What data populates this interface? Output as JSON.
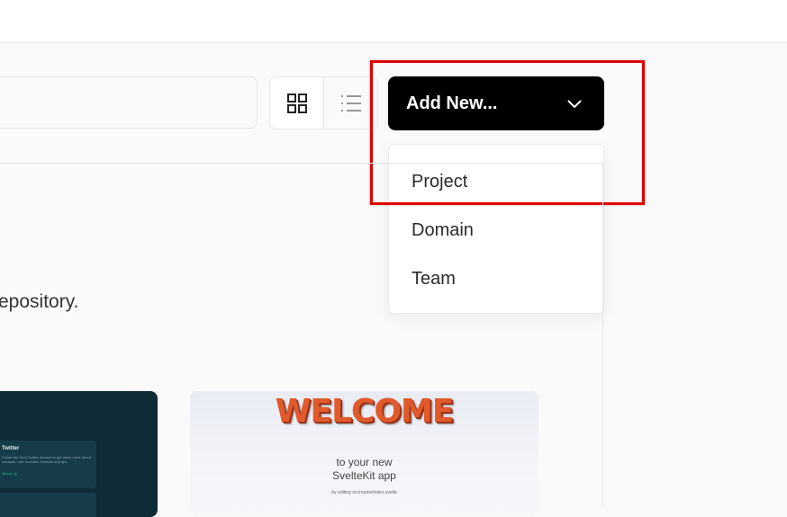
{
  "toolbar": {
    "view_icons": [
      "grid-view-icon",
      "list-view-icon"
    ],
    "add_new": {
      "label": "Add New...",
      "icon": "chevron-down-icon"
    }
  },
  "dropdown": {
    "items": [
      "Project",
      "Domain",
      "Team"
    ]
  },
  "content": {
    "description_fragment": "epository."
  },
  "templates": {
    "twitter_card": {
      "title": "Twitter",
      "description": "Follow the Next Twitter account to get latest news about releases, new modules, tutorials and tips.",
      "link": "@nuxt_js"
    },
    "sveltekit_card": {
      "headline": "WELCOME",
      "line1": "to your new",
      "line2": "SvelteKit app",
      "hint": "try editing src/routes/index.svelte"
    }
  },
  "colors": {
    "accent_button": "#000000",
    "highlight": "#e00000",
    "template_dark": "#0f2b36"
  }
}
